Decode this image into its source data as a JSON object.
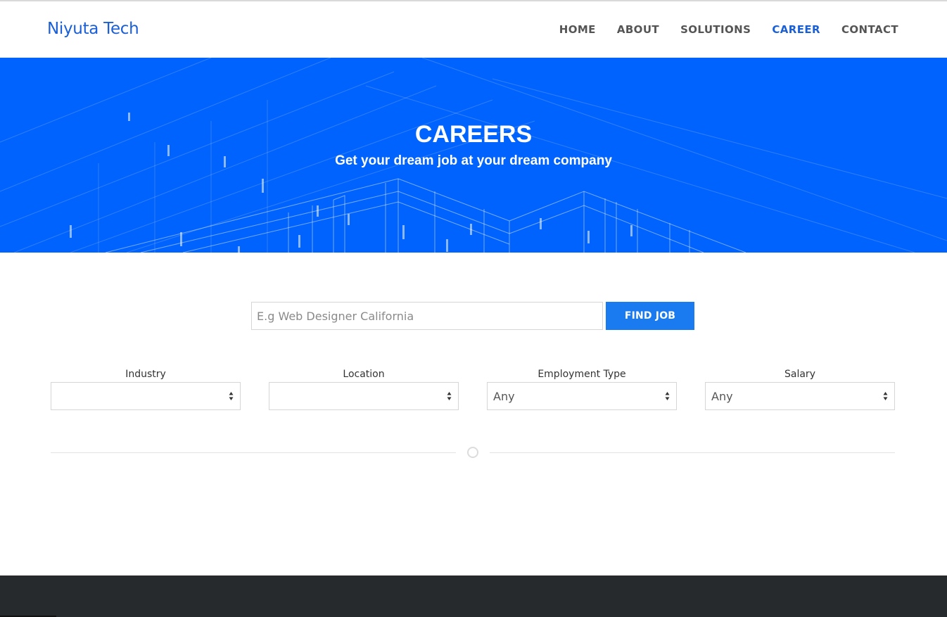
{
  "brand": {
    "name": "Niyuta Tech"
  },
  "nav": {
    "items": [
      {
        "label": "HOME",
        "active": false
      },
      {
        "label": "ABOUT",
        "active": false
      },
      {
        "label": "SOLUTIONS",
        "active": false
      },
      {
        "label": "CAREER",
        "active": true
      },
      {
        "label": "CONTACT",
        "active": false
      }
    ]
  },
  "hero": {
    "title": "CAREERS",
    "subtitle": "Get your dream job at your dream company"
  },
  "search": {
    "placeholder": "E.g Web Designer California",
    "value": "",
    "button_label": "FIND JOB"
  },
  "filters": [
    {
      "label": "Industry",
      "value": ""
    },
    {
      "label": "Location",
      "value": ""
    },
    {
      "label": "Employment Type",
      "value": "Any"
    },
    {
      "label": "Salary",
      "value": "Any"
    }
  ],
  "colors": {
    "accent": "#1a5fd6",
    "hero_bg": "#0063fd",
    "button_bg": "#1a7af0",
    "footer_bg": "#272a2d"
  }
}
